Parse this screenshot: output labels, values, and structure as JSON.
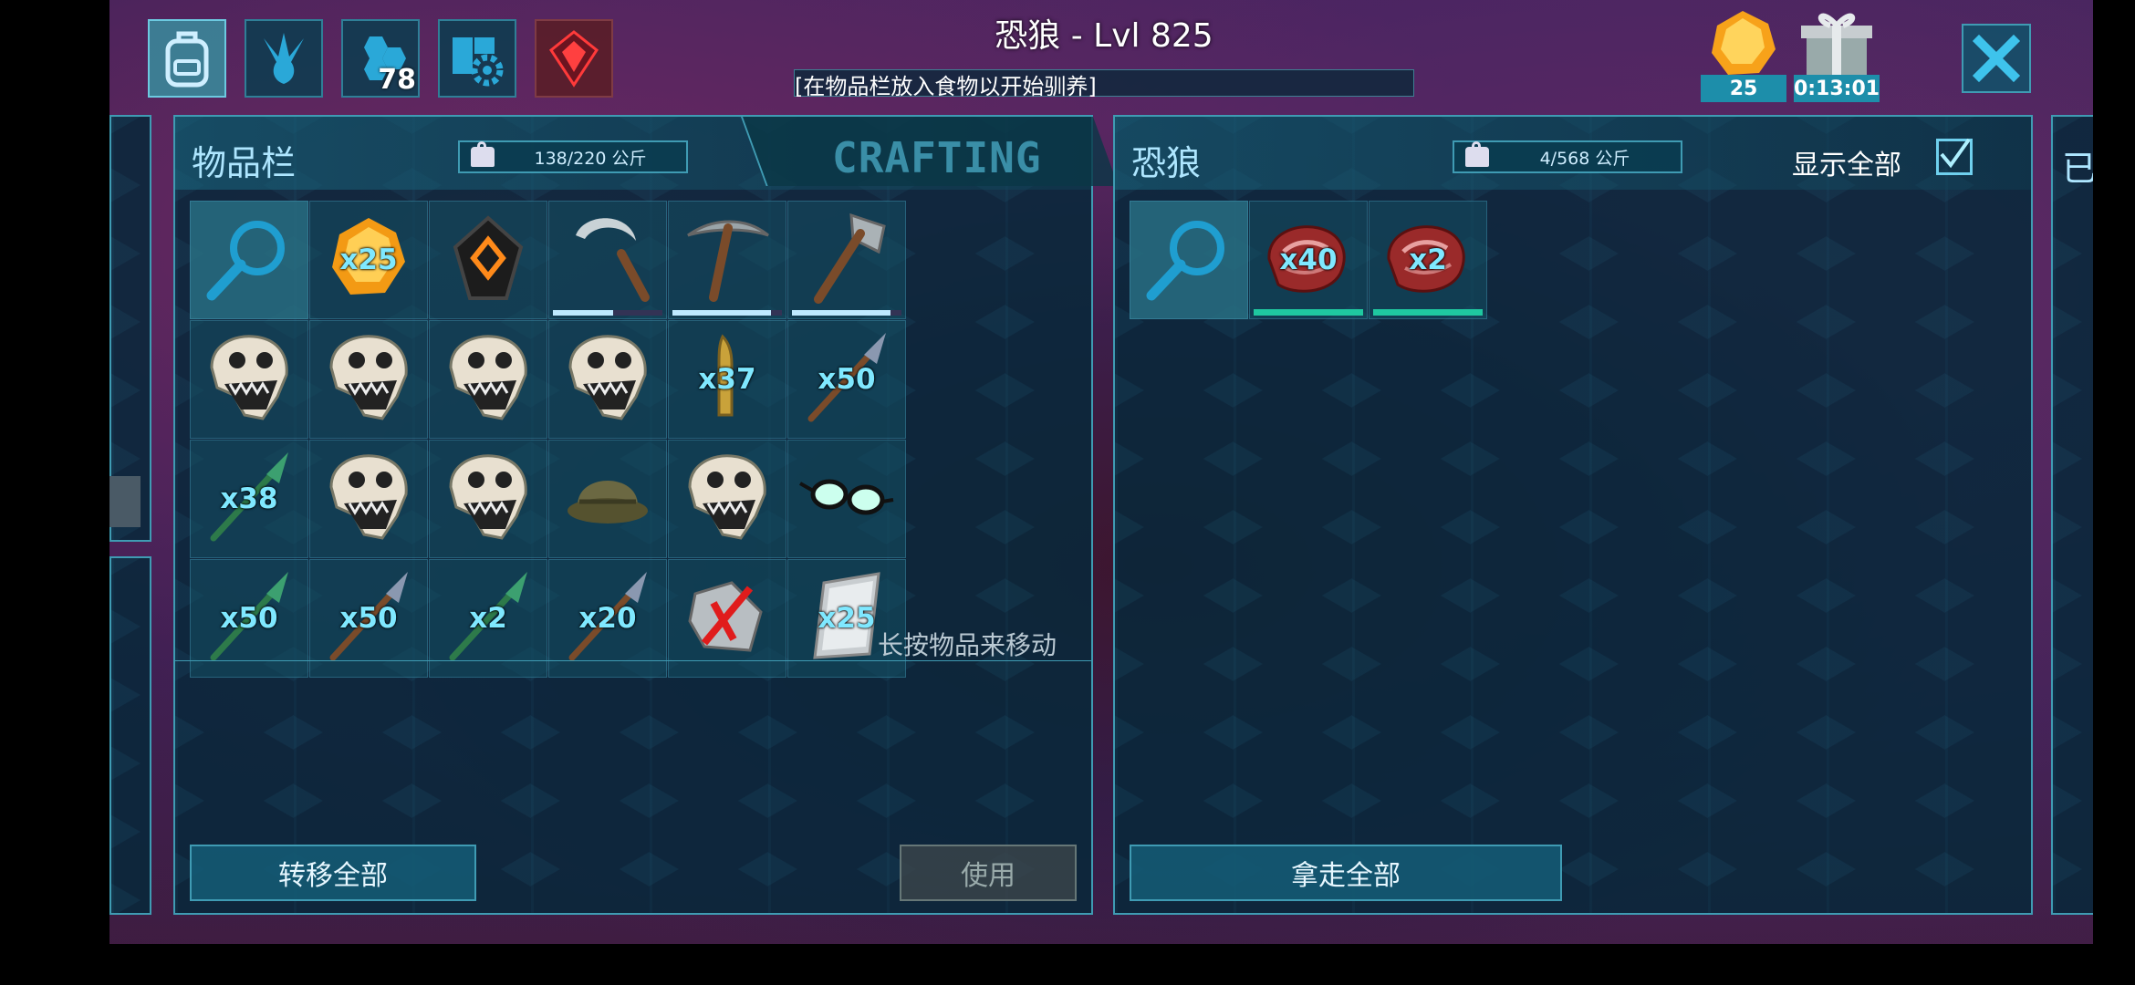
{
  "header": {
    "title": "恐狼 - Lvl 825",
    "taming_hint": "[在物品栏放入食物以开始驯养]",
    "engram_badge": "78",
    "element_count": "25",
    "timer": "0:13:01"
  },
  "left_panel": {
    "title": "物品栏",
    "weight": "138/220 公斤",
    "crafting_tab": "CRAFTING",
    "move_hint": "长按物品来移动",
    "transfer_all": "转移全部",
    "use": "使用",
    "slots": [
      {
        "icon": "search-icon",
        "qty": ""
      },
      {
        "icon": "element-icon",
        "qty": "x25"
      },
      {
        "icon": "implant-icon",
        "qty": ""
      },
      {
        "icon": "sickle-icon",
        "qty": "",
        "durability": 0.55
      },
      {
        "icon": "pickaxe-icon",
        "qty": "",
        "durability": 0.9
      },
      {
        "icon": "hatchet-icon",
        "qty": "",
        "durability": 0.9
      },
      {
        "icon": "skull-icon",
        "qty": ""
      },
      {
        "icon": "skull-icon",
        "qty": ""
      },
      {
        "icon": "skull-icon",
        "qty": ""
      },
      {
        "icon": "skull-icon",
        "qty": ""
      },
      {
        "icon": "bullet-icon",
        "qty": "x37"
      },
      {
        "icon": "spear-icon",
        "qty": "x50"
      },
      {
        "icon": "green-spear-icon",
        "qty": "x38"
      },
      {
        "icon": "skull-icon",
        "qty": ""
      },
      {
        "icon": "skull-icon",
        "qty": ""
      },
      {
        "icon": "pith-helmet-icon",
        "qty": ""
      },
      {
        "icon": "skull-icon",
        "qty": ""
      },
      {
        "icon": "glasses-icon",
        "qty": ""
      },
      {
        "icon": "green-spear-icon",
        "qty": "x50"
      },
      {
        "icon": "spear-icon",
        "qty": "x50"
      },
      {
        "icon": "green-spear-icon",
        "qty": "x2"
      },
      {
        "icon": "spear-icon",
        "qty": "x20"
      },
      {
        "icon": "broken-item-icon",
        "qty": ""
      },
      {
        "icon": "ingot-icon",
        "qty": "x25"
      }
    ]
  },
  "right_panel": {
    "title": "恐狼",
    "weight": "4/568 公斤",
    "show_all": "显示全部",
    "take_all": "拿走全部",
    "slots": [
      {
        "icon": "search-icon",
        "qty": ""
      },
      {
        "icon": "raw-meat-icon",
        "qty": "x40",
        "freshness": 1.0
      },
      {
        "icon": "raw-meat-icon",
        "qty": "x2",
        "freshness": 1.0
      }
    ]
  },
  "far_right_tab": "已"
}
